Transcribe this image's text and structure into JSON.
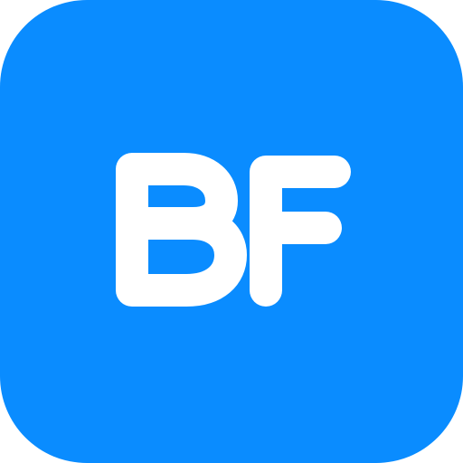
{
  "app_icon": {
    "monogram": "BF",
    "background_color": "#0A8CFF",
    "glyph_color": "#FFFFFF"
  }
}
